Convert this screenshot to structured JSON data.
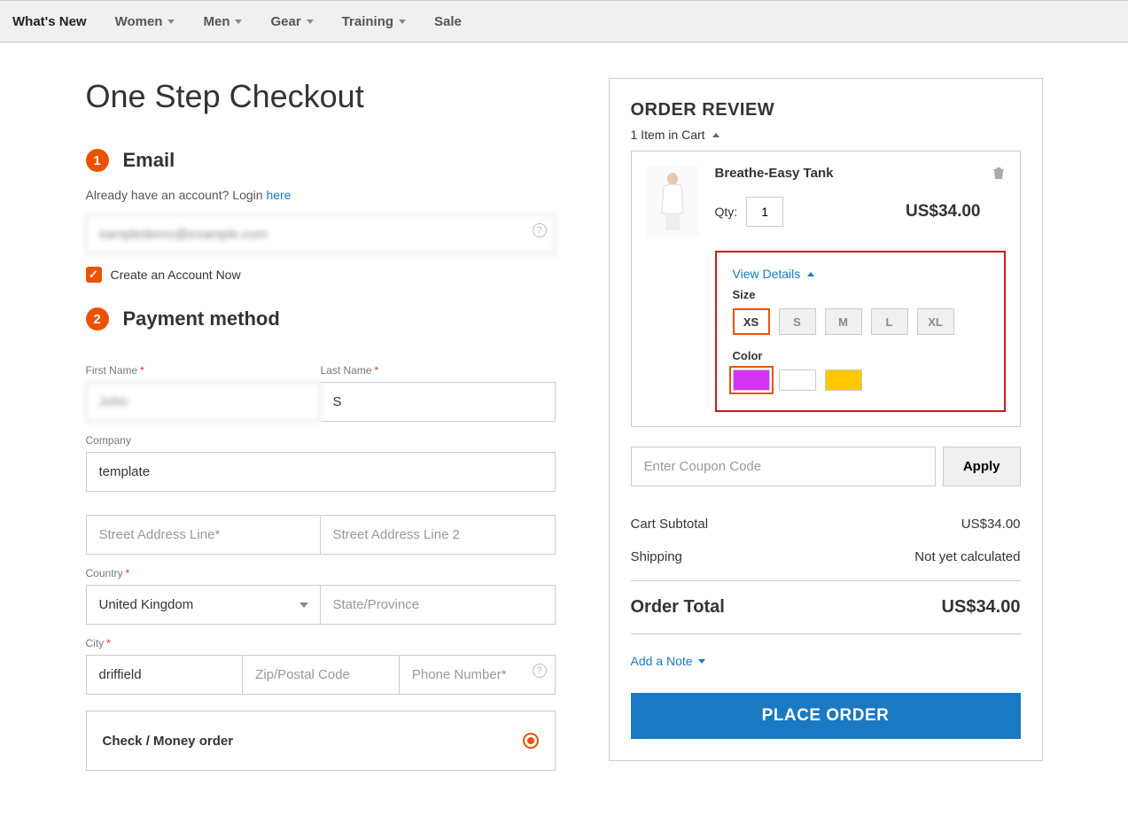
{
  "nav": [
    "What's New",
    "Women",
    "Men",
    "Gear",
    "Training",
    "Sale"
  ],
  "nav_has_dropdown": [
    false,
    true,
    true,
    true,
    true,
    false
  ],
  "page_title": "One Step Checkout",
  "steps": {
    "email": "Email",
    "payment": "Payment method"
  },
  "already": {
    "text": "Already have an account? Login ",
    "link": "here"
  },
  "email_val": "sampledemo@example.com",
  "create_account": "Create an Account Now",
  "labels": {
    "first": "First Name",
    "last": "Last Name",
    "company": "Company",
    "street1": "Street Address Line",
    "street2": "Street Address Line 2",
    "country": "Country",
    "state": "State/Province",
    "city": "City",
    "zip": "Zip/Postal Code",
    "phone": "Phone Number"
  },
  "values": {
    "first": "John",
    "last": "S",
    "company": "template",
    "country": "United Kingdom",
    "city": "driffield"
  },
  "payment_method": "Check / Money order",
  "review": {
    "title": "ORDER REVIEW",
    "count_text": "1 Item in Cart",
    "item": {
      "name": "Breathe-Easy Tank",
      "qty_label": "Qty:",
      "qty": "1",
      "price": "US$34.00",
      "view_details": "View Details",
      "size_label": "Size",
      "sizes": [
        "XS",
        "S",
        "M",
        "L",
        "XL"
      ],
      "size_selected": "XS",
      "color_label": "Color",
      "colors": [
        "#d233f0",
        "#ffffff",
        "#ffc700"
      ],
      "color_selected": 0
    },
    "coupon_placeholder": "Enter Coupon Code",
    "apply": "Apply",
    "subtotal_label": "Cart Subtotal",
    "subtotal_val": "US$34.00",
    "shipping_label": "Shipping",
    "shipping_val": "Not yet calculated",
    "total_label": "Order Total",
    "total_val": "US$34.00",
    "add_note": "Add a Note",
    "place": "PLACE ORDER"
  }
}
